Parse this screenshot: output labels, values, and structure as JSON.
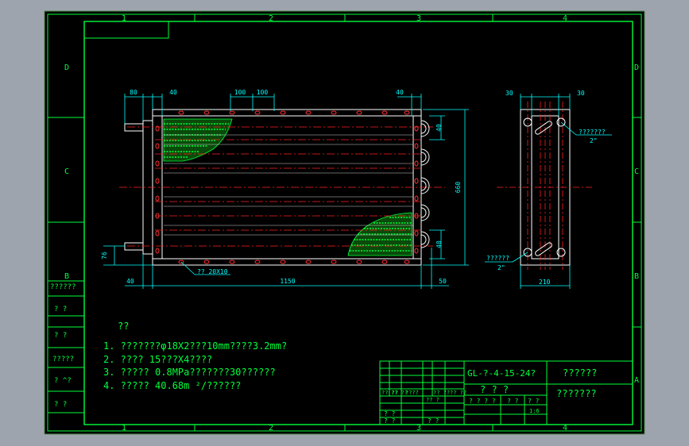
{
  "border": {
    "top_zones": [
      "1",
      "2",
      "3",
      "4"
    ],
    "bottom_zones": [
      "1",
      "2",
      "3",
      "4"
    ],
    "left_zones": [
      "D",
      "C",
      "B"
    ],
    "right_zones": [
      "D",
      "C",
      "B",
      "A"
    ]
  },
  "left_strip": [
    "??????",
    "?  ?",
    "?  ?",
    "?????",
    "? ^?",
    "?  ?"
  ],
  "front_view": {
    "dims": {
      "d80": "80",
      "d40a": "40",
      "d100a": "100",
      "d100b": "100",
      "d40b": "40",
      "d40bottom": "40",
      "d1150": "1150",
      "d50": "50",
      "d76": "76",
      "d40r1": "40",
      "d660": "660",
      "d40r2": "40"
    },
    "callout": "??  20X10"
  },
  "side_view": {
    "dims": {
      "d30a": "30",
      "d30b": "30",
      "d210": "210"
    },
    "callout_top": "???????",
    "callout_top_sub": "2\"",
    "callout_bottom": "??????",
    "callout_bottom_sub": "2\""
  },
  "notes": {
    "heading": "??",
    "items": [
      "1. ???????φ18X2???10mm????3.2mm?",
      "2. ????  15???X4????",
      "3. ?????  0.8MPa???????30??????",
      "4. ?????  40.68m ²/??????"
    ]
  },
  "title_block": {
    "drawing_no": "GL-?-4-15-24?",
    "title_right": "??????",
    "name_sub": "?  ?  ?",
    "org": "???????",
    "hdr_cells": [
      "?? ??",
      "?? ??",
      "????",
      "?? ??",
      "?? ??"
    ],
    "row_b": "?? ?",
    "cell_a": "? ? ? ?",
    "cell_b": "? ?",
    "cell_c": "? ?",
    "scale": "1:6",
    "left_a": "? ?",
    "left_b": "? ?",
    "left_c": "? ?"
  },
  "colors": {
    "background": "#9ea4ad",
    "sheet": "#000000",
    "frame": "#00ff3c",
    "dimension": "#00ffff",
    "centerline": "#ff2020",
    "tube": "#ffffff",
    "fins": "#00ff3c"
  }
}
